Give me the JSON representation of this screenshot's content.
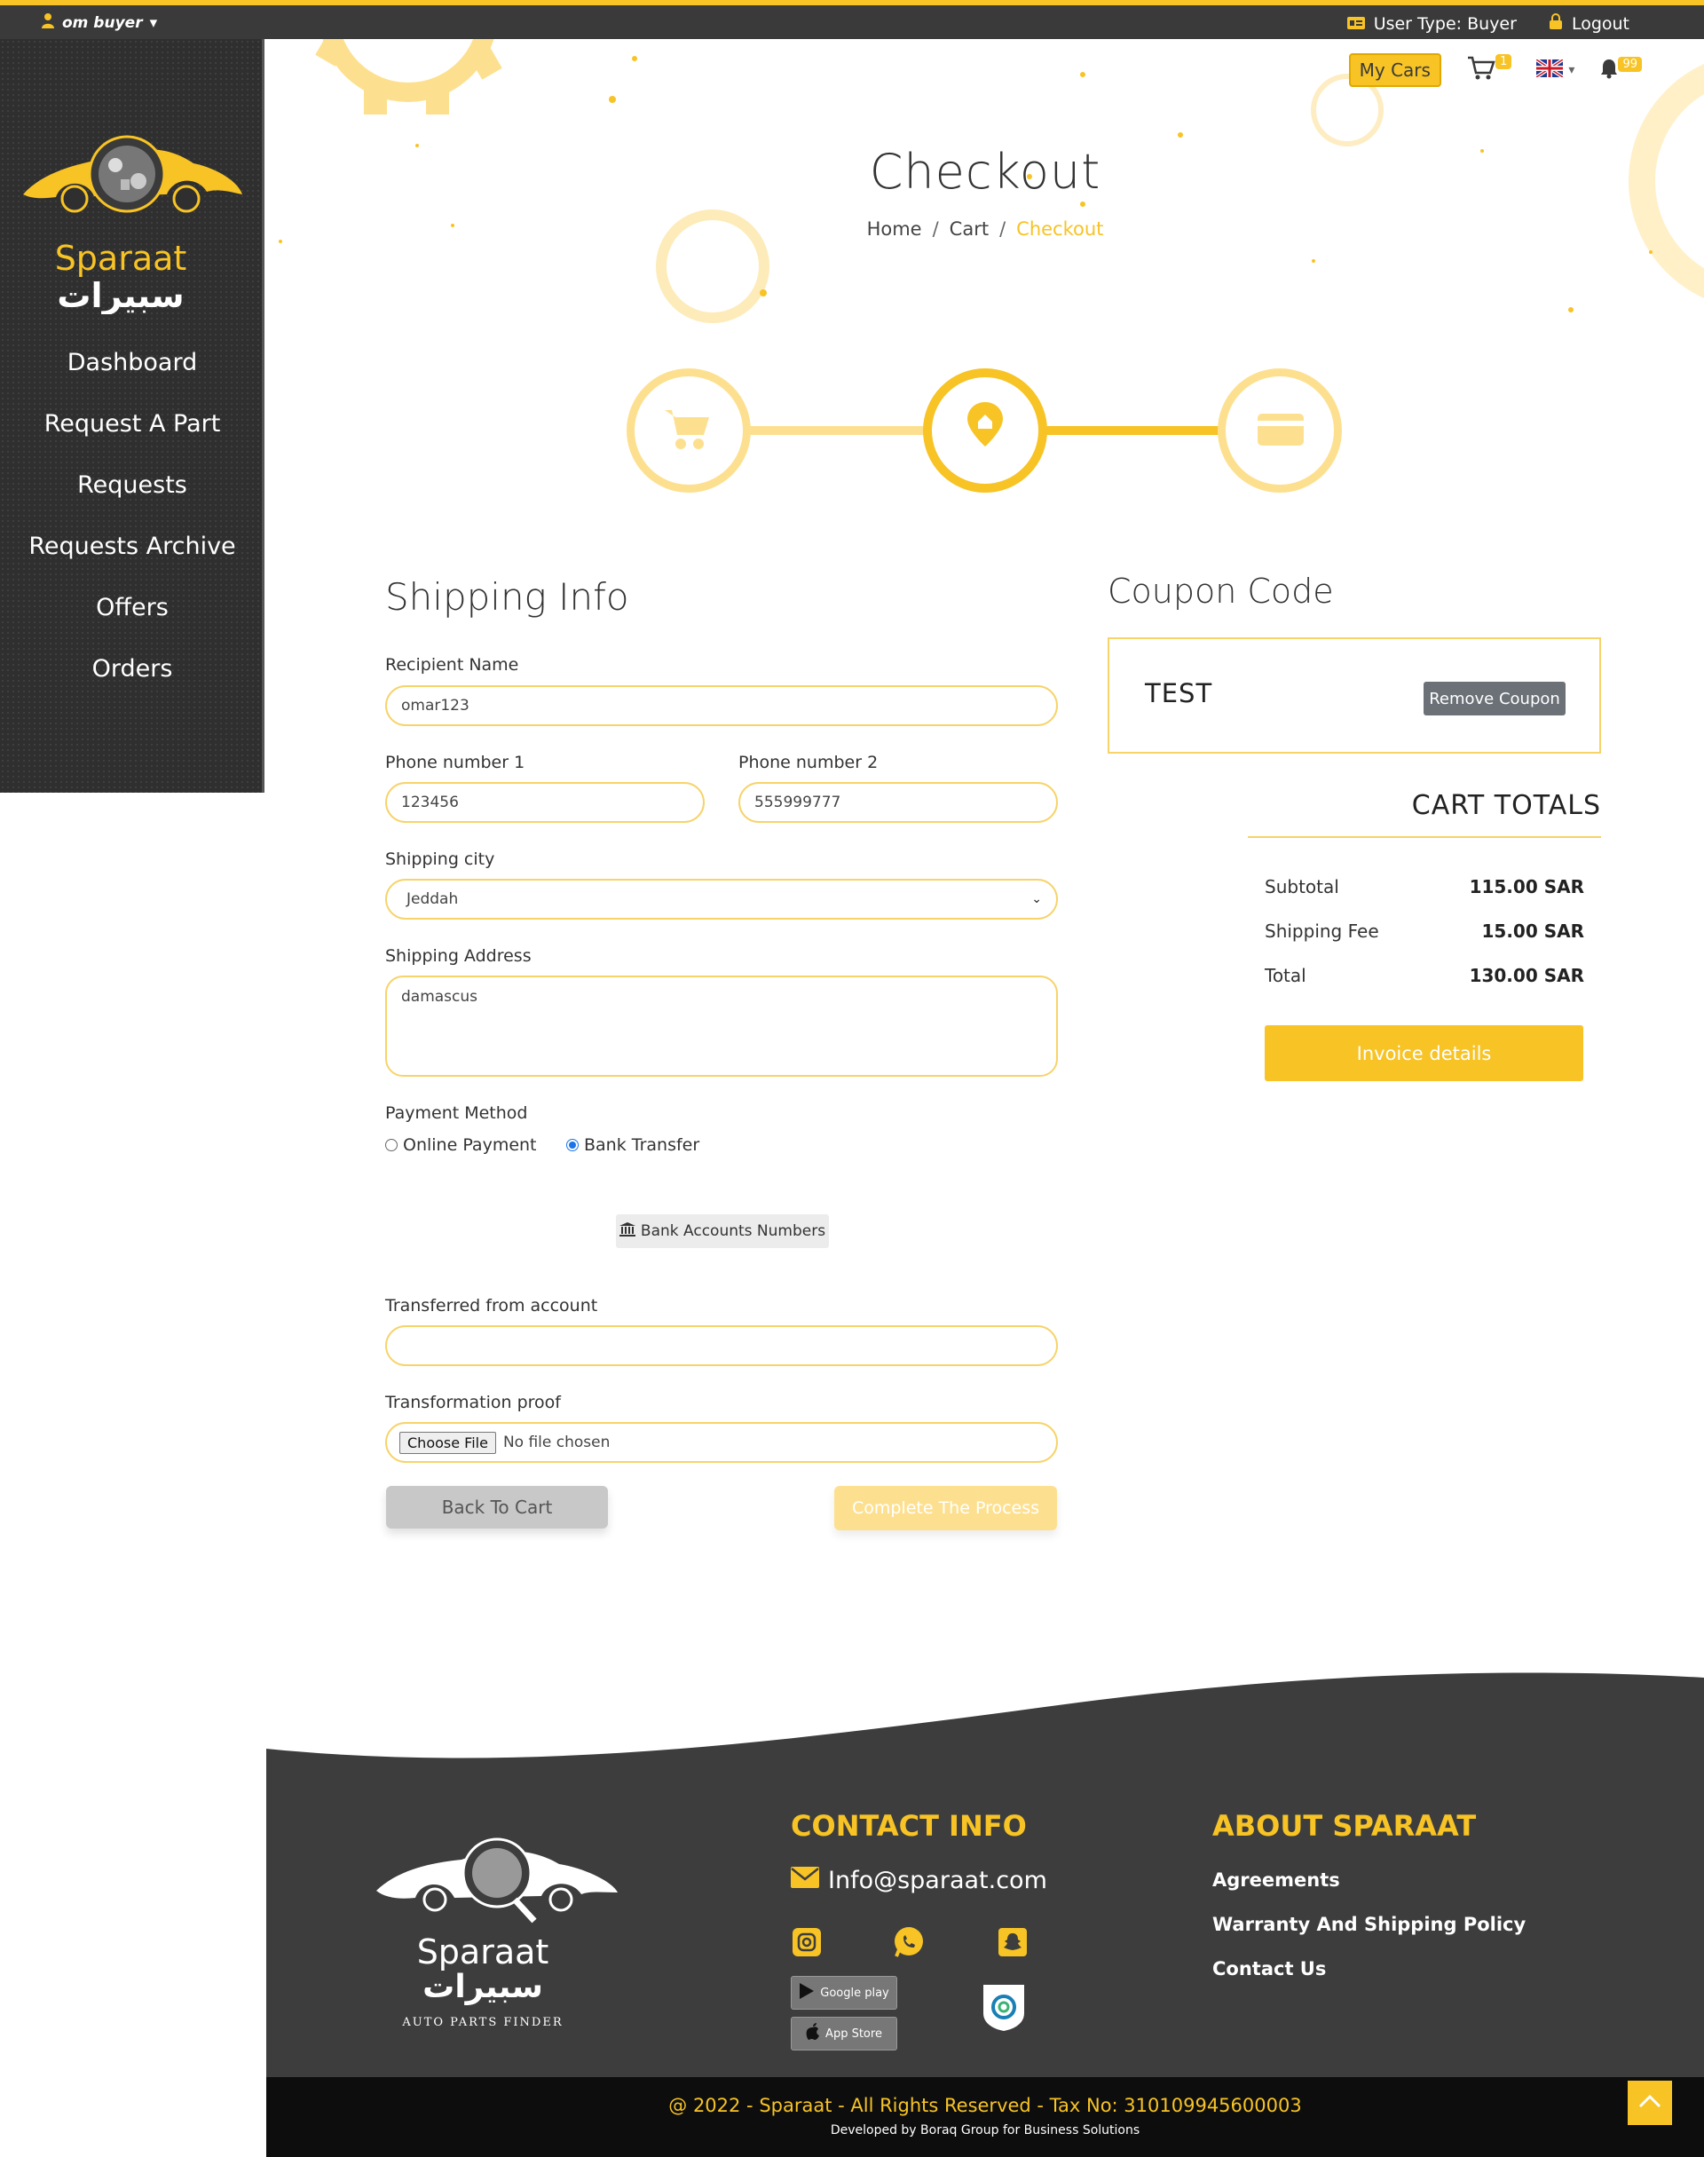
{
  "topbar": {
    "user_name": "om buyer",
    "user_type": "User Type: Buyer",
    "logout": "Logout"
  },
  "brand": {
    "name_en": "Sparaat",
    "name_ar": "سبيرات",
    "tagline": "AUTO PARTS FINDER"
  },
  "sidebar": {
    "items": [
      {
        "label": "Dashboard"
      },
      {
        "label": "Request A Part"
      },
      {
        "label": "Requests"
      },
      {
        "label": "Requests Archive"
      },
      {
        "label": "Offers"
      },
      {
        "label": "Orders"
      }
    ]
  },
  "header": {
    "my_cars": "My Cars",
    "cart_count": "1",
    "notif_count": "99"
  },
  "page": {
    "title": "Checkout",
    "breadcrumb": {
      "home": "Home",
      "sep": "/",
      "cart": "Cart",
      "current": "Checkout"
    }
  },
  "shipping": {
    "title": "Shipping Info",
    "recipient_label": "Recipient Name",
    "recipient_value": "omar123",
    "phone1_label": "Phone number 1",
    "phone1_value": "123456",
    "phone2_label": "Phone number 2",
    "phone2_value": "555999777",
    "city_label": "Shipping city",
    "city_value": "Jeddah",
    "address_label": "Shipping Address",
    "address_value": "damascus",
    "payment_label": "Payment Method",
    "payment_online": "Online Payment",
    "payment_bank": "Bank Transfer",
    "bank_accounts_btn": "Bank Accounts Numbers",
    "transferred_label": "Transferred from account",
    "proof_label": "Transformation proof",
    "choose_file": "Choose File",
    "no_file": "No file chosen",
    "back_btn": "Back To Cart",
    "complete_btn": "Complete The Process"
  },
  "coupon": {
    "title": "Coupon Code",
    "code": "TEST",
    "remove_btn": "Remove Coupon"
  },
  "totals": {
    "title": "CART TOTALS",
    "rows": [
      {
        "label": "Subtotal",
        "value": "115.00 SAR"
      },
      {
        "label": "Shipping Fee",
        "value": "15.00 SAR"
      },
      {
        "label": "Total",
        "value": "130.00 SAR"
      }
    ],
    "invoice_btn": "Invoice details"
  },
  "footer": {
    "contact_title": "CONTACT INFO",
    "email": "Info@sparaat.com",
    "about_title": "ABOUT SPARAAT",
    "links": [
      {
        "label": "Agreements"
      },
      {
        "label": "Warranty And Shipping Policy"
      },
      {
        "label": "Contact Us"
      }
    ],
    "google_play": "Google play",
    "app_store": "App Store",
    "copyright": "@ 2022 - Sparaat - All Rights Reserved - Tax No: 310109945600003",
    "developer": "Developed by Boraq Group for Business Solutions"
  },
  "colors": {
    "accent": "#f7c325",
    "accent_light": "#fde08f",
    "dark": "#3a3a3a"
  }
}
